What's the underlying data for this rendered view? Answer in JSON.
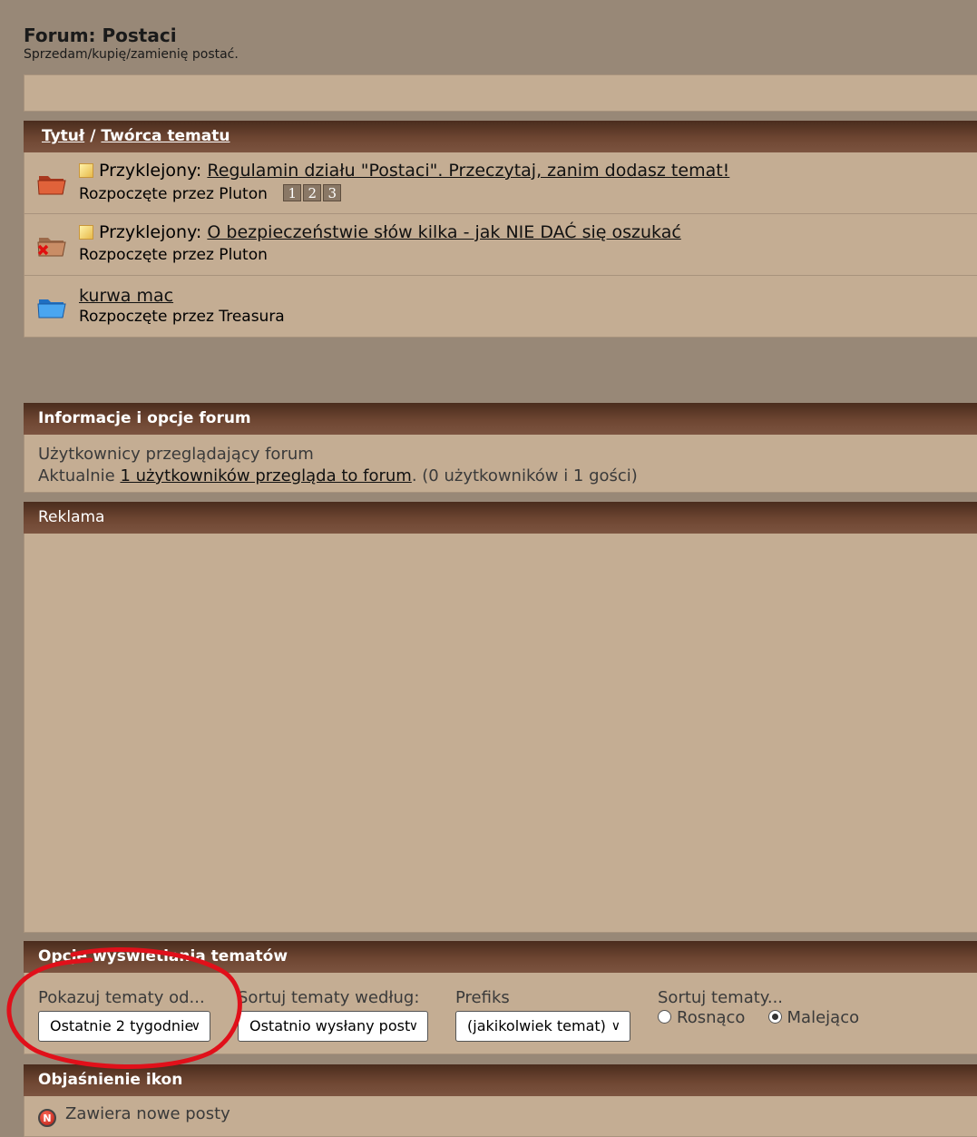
{
  "header": {
    "title": "Forum: Postaci",
    "description": "Sprzedam/kupię/zamienię postać."
  },
  "threads_table": {
    "col_title": "Tytuł",
    "col_sep": "/",
    "col_author": "Twórca tematu",
    "rows": [
      {
        "prefix": "Przyklejony:",
        "title": "Regulamin działu \"Postaci\". Przeczytaj, zanim dodasz temat!",
        "started_by": "Rozpoczęte przez Pluton",
        "pages": [
          "1",
          "2",
          "3"
        ],
        "folder_icon": "folder-red-icon"
      },
      {
        "prefix": "Przyklejony:",
        "title": "O bezpieczeństwie słów kilka - jak NIE DAĆ się oszukać",
        "started_by": "Rozpoczęte przez Pluton",
        "folder_icon": "folder-locked-icon"
      },
      {
        "title": "kurwa mac",
        "started_by": "Rozpoczęte przez Treasura",
        "folder_icon": "folder-blue-icon"
      }
    ]
  },
  "forum_info": {
    "title": "Informacje i opcje forum",
    "users_heading": "Użytkownicy przeglądający forum",
    "currently_prefix": "Aktualnie",
    "users_link": "1 użytkowników przegląda to forum",
    "users_suffix": ". (0 użytkowników i 1 gości)"
  },
  "ad": {
    "title": "Reklama"
  },
  "display_options": {
    "title": "Opcje wyświetlania tematów",
    "show_from_label": "Pokazuj tematy od...",
    "show_from_value": "Ostatnie 2 tygodnie",
    "sort_by_label": "Sortuj tematy według:",
    "sort_by_value": "Ostatnio wysłany post",
    "prefix_label": "Prefiks",
    "prefix_value": "(jakikolwiek temat)",
    "order_label": "Sortuj tematy...",
    "asc_label": "Rosnąco",
    "desc_label": "Malejąco",
    "selected_order": "desc"
  },
  "icon_legend": {
    "title": "Objaśnienie ikon",
    "new_posts": "Zawiera nowe posty"
  },
  "colors": {
    "page_bg": "#988877",
    "panel_bg": "#c4ad93",
    "header_bar": "#5c3a28",
    "annotation": "#e0101a"
  }
}
